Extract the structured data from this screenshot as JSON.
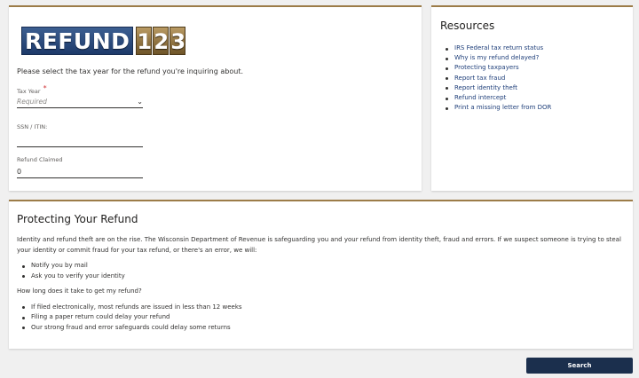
{
  "logo": {
    "word": "REFUND",
    "digits": [
      "1",
      "2",
      "3"
    ]
  },
  "form": {
    "intro": "Please select the tax year for the refund you're inquiring about.",
    "tax_year": {
      "label": "Tax Year",
      "required_mark": "*",
      "placeholder": "Required"
    },
    "ssn": {
      "label": "SSN / ITIN:",
      "value": ""
    },
    "refund": {
      "label": "Refund Claimed",
      "value": "0"
    }
  },
  "resources": {
    "title": "Resources",
    "links": [
      "IRS Federal tax return status",
      "Why is my refund delayed?",
      "Protecting taxpayers",
      "Report tax fraud",
      "Report identity theft",
      "Refund intercept",
      "Print a missing letter from DOR"
    ]
  },
  "protect": {
    "title": "Protecting Your Refund",
    "paragraph": "Identity and refund theft are on the rise. The Wisconsin Department of Revenue is safeguarding you and your refund from identity theft, fraud and errors. If we suspect someone is trying to steal your identity or commit fraud for your tax refund, or there's an error, we will:",
    "we_will": [
      "Notify you by mail",
      "Ask you to verify your identity"
    ],
    "question": "How long does it take to get my refund?",
    "answers": [
      "If filed electronically, most refunds are issued in less than 12 weeks",
      "Filing a paper return could delay your refund",
      "Our strong fraud and error safeguards could delay some returns"
    ]
  },
  "search_label": "Search",
  "colors": {
    "accent": "#9c7c48",
    "link": "#1f3f7a",
    "button": "#1b2f4d"
  }
}
